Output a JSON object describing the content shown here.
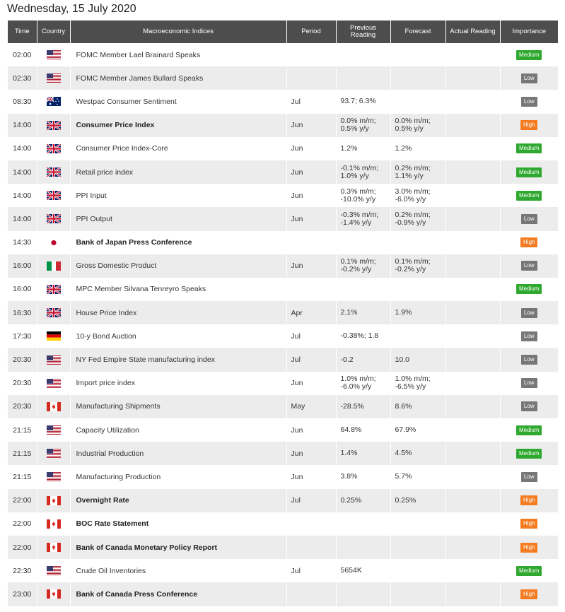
{
  "page": {
    "date_title": "Wednesday, 15 July 2020"
  },
  "table": {
    "headers": {
      "time": "Time",
      "country": "Country",
      "index": "Macroeconomic Indices",
      "period": "Period",
      "previous": "Previous Reading",
      "forecast": "Forecast",
      "actual": "Actual Reading",
      "importance": "Importance"
    },
    "rows": [
      {
        "time": "02:00",
        "country": "us",
        "index": "FOMC Member Lael Brainard Speaks",
        "bold": false,
        "period": "",
        "prev1": "",
        "prev2": "",
        "fc1": "",
        "fc2": "",
        "actual": "",
        "importance": "Medium"
      },
      {
        "time": "02:30",
        "country": "us",
        "index": "FOMC Member James Bullard Speaks",
        "bold": false,
        "period": "",
        "prev1": "",
        "prev2": "",
        "fc1": "",
        "fc2": "",
        "actual": "",
        "importance": "Low"
      },
      {
        "time": "08:30",
        "country": "au",
        "index": "Westpac Consumer Sentiment",
        "bold": false,
        "period": "Jul",
        "prev1": "93.7; 6.3%",
        "prev2": "",
        "fc1": "",
        "fc2": "",
        "actual": "",
        "importance": "Low"
      },
      {
        "time": "14:00",
        "country": "uk",
        "index": "Consumer Price Index",
        "bold": true,
        "period": "Jun",
        "prev1": "0.0% m/m;",
        "prev2": "0.5% y/y",
        "fc1": "0.0% m/m;",
        "fc2": "0.5% y/y",
        "actual": "",
        "importance": "High"
      },
      {
        "time": "14:00",
        "country": "uk",
        "index": "Consumer Price Index-Core",
        "bold": false,
        "period": "Jun",
        "prev1": "1.2%",
        "prev2": "",
        "fc1": "1.2%",
        "fc2": "",
        "actual": "",
        "importance": "Medium"
      },
      {
        "time": "14:00",
        "country": "uk",
        "index": "Retail price index",
        "bold": false,
        "period": "Jun",
        "prev1": "-0.1% m/m;",
        "prev2": "1.0% y/y",
        "fc1": "0.2% m/m;",
        "fc2": "1.1% y/y",
        "actual": "",
        "importance": "Medium"
      },
      {
        "time": "14:00",
        "country": "uk",
        "index": "PPI Input",
        "bold": false,
        "period": "Jun",
        "prev1": "0.3% m/m;",
        "prev2": "-10.0% y/y",
        "fc1": "3.0% m/m;",
        "fc2": "-6.0% y/y",
        "actual": "",
        "importance": "Medium"
      },
      {
        "time": "14:00",
        "country": "uk",
        "index": "PPI Output",
        "bold": false,
        "period": "Jun",
        "prev1": "-0.3% m/m;",
        "prev2": "-1.4% y/y",
        "fc1": "0.2% m/m;",
        "fc2": "-0.9% y/y",
        "actual": "",
        "importance": "Low"
      },
      {
        "time": "14:30",
        "country": "jp",
        "index": "Bank of Japan Press Conference",
        "bold": true,
        "period": "",
        "prev1": "",
        "prev2": "",
        "fc1": "",
        "fc2": "",
        "actual": "",
        "importance": "High"
      },
      {
        "time": "16:00",
        "country": "it",
        "index": "Gross Domestic Product",
        "bold": false,
        "period": "Jun",
        "prev1": "0.1% m/m;",
        "prev2": "-0.2% y/y",
        "fc1": "0.1% m/m;",
        "fc2": "-0.2% y/y",
        "actual": "",
        "importance": "Low"
      },
      {
        "time": "16:00",
        "country": "uk",
        "index": "MPC Member Silvana Tenreyro Speaks",
        "bold": false,
        "period": "",
        "prev1": "",
        "prev2": "",
        "fc1": "",
        "fc2": "",
        "actual": "",
        "importance": "Medium"
      },
      {
        "time": "16:30",
        "country": "uk",
        "index": "House Price Index",
        "bold": false,
        "period": "Apr",
        "prev1": "2.1%",
        "prev2": "",
        "fc1": "1.9%",
        "fc2": "",
        "actual": "",
        "importance": "Low"
      },
      {
        "time": "17:30",
        "country": "de",
        "index": "10-y Bond Auction",
        "bold": false,
        "period": "Jul",
        "prev1": "-0.38%; 1.8",
        "prev2": "",
        "fc1": "",
        "fc2": "",
        "actual": "",
        "importance": "Low"
      },
      {
        "time": "20:30",
        "country": "us",
        "index": "NY Fed Empire State manufacturing index",
        "bold": false,
        "period": "Jul",
        "prev1": "-0.2",
        "prev2": "",
        "fc1": "10.0",
        "fc2": "",
        "actual": "",
        "importance": "Low"
      },
      {
        "time": "20:30",
        "country": "us",
        "index": "Import price index",
        "bold": false,
        "period": "Jun",
        "prev1": "1.0% m/m;",
        "prev2": "-6.0% y/y",
        "fc1": "1.0% m/m;",
        "fc2": "-6.5% y/y",
        "actual": "",
        "importance": "Low"
      },
      {
        "time": "20:30",
        "country": "ca",
        "index": "Manufacturing Shipments",
        "bold": false,
        "period": "May",
        "prev1": "-28.5%",
        "prev2": "",
        "fc1": "8.6%",
        "fc2": "",
        "actual": "",
        "importance": "Low"
      },
      {
        "time": "21:15",
        "country": "us",
        "index": "Capacity Utilization",
        "bold": false,
        "period": "Jun",
        "prev1": "64.8%",
        "prev2": "",
        "fc1": "67.9%",
        "fc2": "",
        "actual": "",
        "importance": "Medium"
      },
      {
        "time": "21:15",
        "country": "us",
        "index": "Industrial Production",
        "bold": false,
        "period": "Jun",
        "prev1": "1.4%",
        "prev2": "",
        "fc1": "4.5%",
        "fc2": "",
        "actual": "",
        "importance": "Medium"
      },
      {
        "time": "21:15",
        "country": "us",
        "index": "Manufacturing Production",
        "bold": false,
        "period": "Jun",
        "prev1": "3.8%",
        "prev2": "",
        "fc1": "5.7%",
        "fc2": "",
        "actual": "",
        "importance": "Low"
      },
      {
        "time": "22:00",
        "country": "ca",
        "index": "Overnight Rate",
        "bold": true,
        "period": "Jul",
        "prev1": "0.25%",
        "prev2": "",
        "fc1": "0.25%",
        "fc2": "",
        "actual": "",
        "importance": "High"
      },
      {
        "time": "22:00",
        "country": "ca",
        "index": "BOC Rate Statement",
        "bold": true,
        "period": "",
        "prev1": "",
        "prev2": "",
        "fc1": "",
        "fc2": "",
        "actual": "",
        "importance": "High"
      },
      {
        "time": "22:00",
        "country": "ca",
        "index": "Bank of Canada Monetary Policy Report",
        "bold": true,
        "period": "",
        "prev1": "",
        "prev2": "",
        "fc1": "",
        "fc2": "",
        "actual": "",
        "importance": "High"
      },
      {
        "time": "22:30",
        "country": "us",
        "index": "Crude Oil Inventories",
        "bold": false,
        "period": "Jul",
        "prev1": "5654K",
        "prev2": "",
        "fc1": "",
        "fc2": "",
        "actual": "",
        "importance": "Medium"
      },
      {
        "time": "23:00",
        "country": "ca",
        "index": "Bank of Canada Press Conference",
        "bold": true,
        "period": "",
        "prev1": "",
        "prev2": "",
        "fc1": "",
        "fc2": "",
        "actual": "",
        "importance": "High"
      }
    ]
  },
  "flag_names": {
    "us": "us-flag-icon",
    "uk": "uk-flag-icon",
    "au": "australia-flag-icon",
    "jp": "japan-flag-icon",
    "it": "italy-flag-icon",
    "de": "germany-flag-icon",
    "ca": "canada-flag-icon"
  },
  "colors": {
    "header_bg": "#4d4d4d",
    "row_alt": "#ececec",
    "importance_medium": "#2ea82e",
    "importance_low": "#777777",
    "importance_high": "#f47b20"
  }
}
